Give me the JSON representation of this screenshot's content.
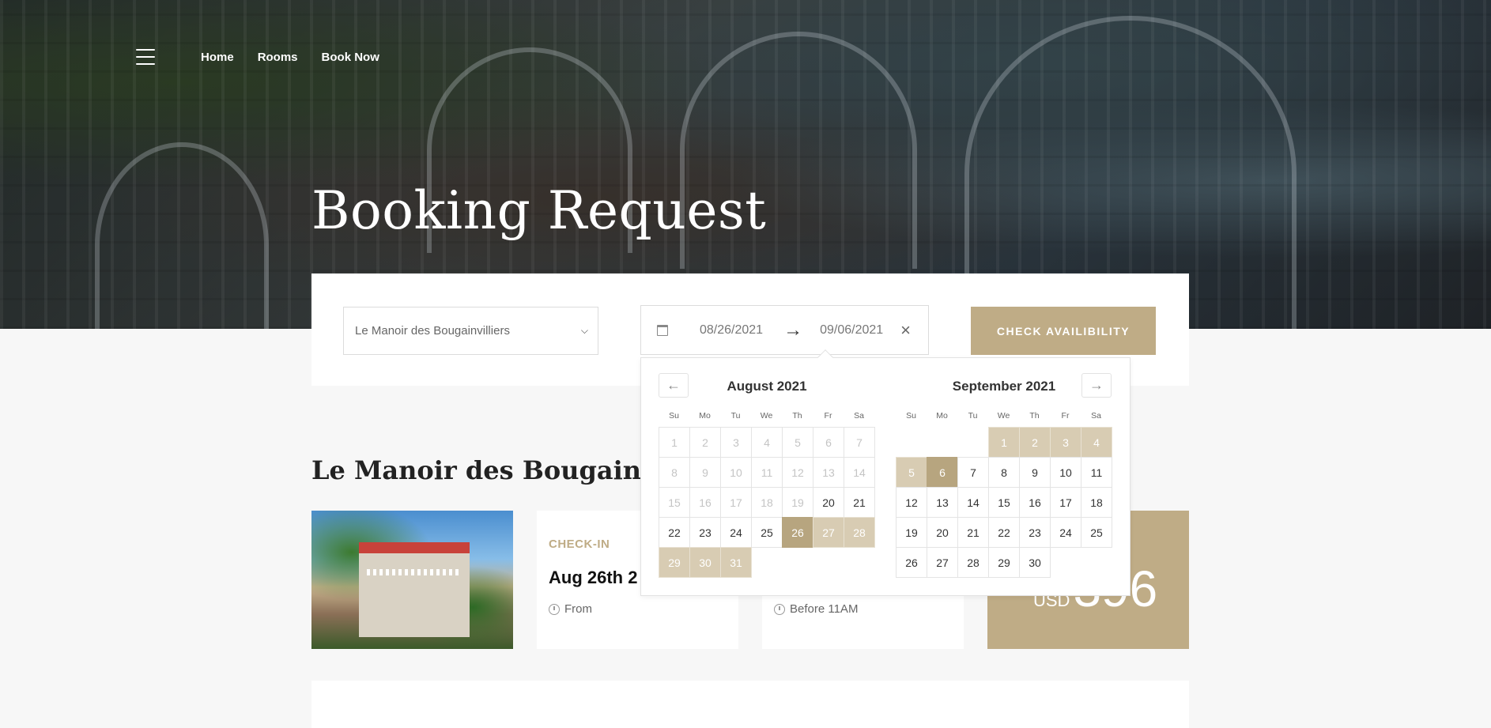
{
  "nav": {
    "links": [
      "Home",
      "Rooms",
      "Book Now"
    ]
  },
  "hero": {
    "title": "Booking Request"
  },
  "search": {
    "hotel_value": "Le Manoir des Bougainvilliers",
    "start_date": "08/26/2021",
    "end_date": "09/06/2021",
    "check_label": "CHECK AVAILIBILITY"
  },
  "datepicker": {
    "prev_icon": "arrow-left-icon",
    "next_icon": "arrow-right-icon",
    "weekdays": [
      "Su",
      "Mo",
      "Tu",
      "We",
      "Th",
      "Fr",
      "Sa"
    ],
    "months": [
      {
        "title": "August 2021",
        "leading_blanks": 0,
        "days": 31,
        "disabled_until": 19,
        "range_start": 26,
        "range_end": 31,
        "selected": [
          26
        ]
      },
      {
        "title": "September 2021",
        "leading_blanks": 3,
        "days": 30,
        "disabled_until": 0,
        "range_start": 1,
        "range_end": 6,
        "selected": [
          6
        ]
      }
    ]
  },
  "section": {
    "title": "Le Manoir des Bougainvill"
  },
  "checkin": {
    "label": "CHECK-IN",
    "value": "Aug 26th 2",
    "time": "From"
  },
  "checkout": {
    "time": "Before 11AM"
  },
  "price": {
    "currency": "USD",
    "amount": "396"
  },
  "colors": {
    "accent": "#bfac86",
    "range": "#d8ccb3",
    "selected": "#b7a57f"
  }
}
